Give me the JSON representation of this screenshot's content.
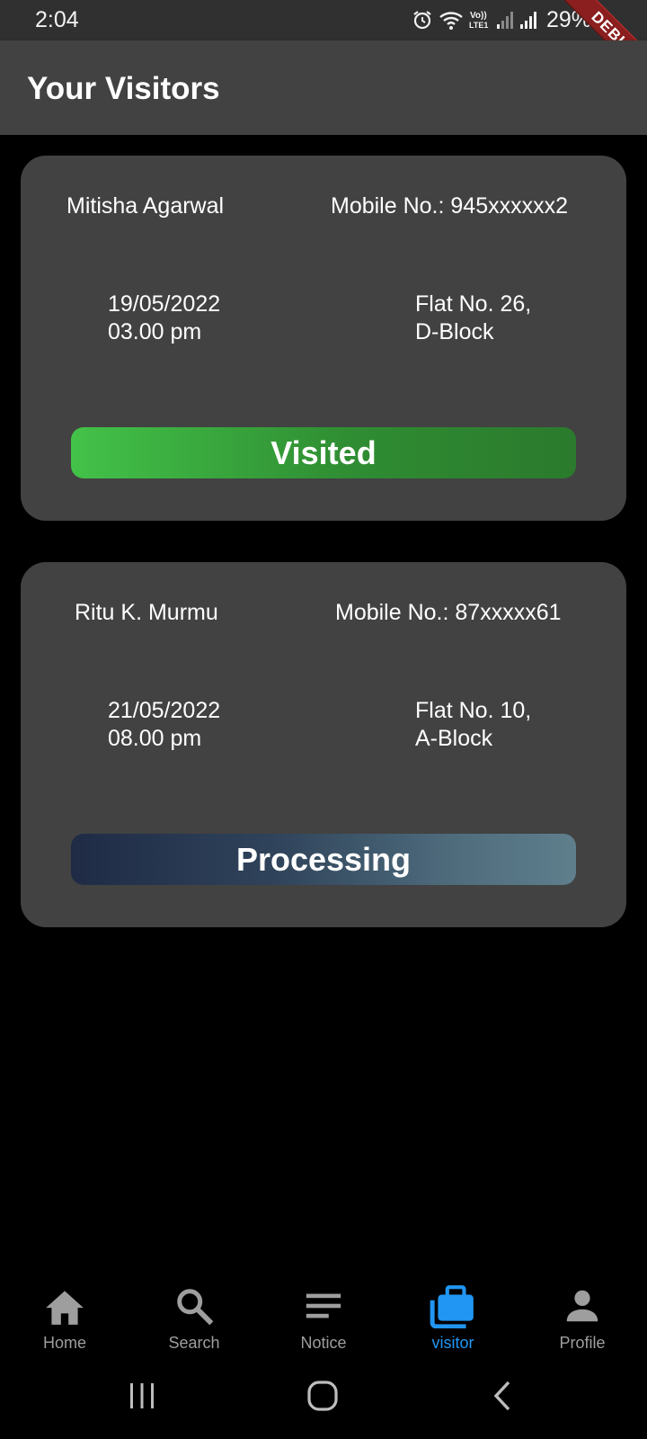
{
  "status_bar": {
    "time": "2:04",
    "battery": "29%"
  },
  "debug_label": "DEBUG",
  "app_bar": {
    "title": "Your Visitors"
  },
  "visitors": [
    {
      "name": "Mitisha Agarwal",
      "mobile": "Mobile No.: 945xxxxxx2",
      "date": "19/05/2022",
      "time": "03.00 pm",
      "flat_line1": "Flat No. 26,",
      "flat_line2": "D-Block",
      "status": "Visited"
    },
    {
      "name": "Ritu K. Murmu",
      "mobile": "Mobile No.: 87xxxxx61",
      "date": "21/05/2022",
      "time": "08.00 pm",
      "flat_line1": "Flat No. 10,",
      "flat_line2": "A-Block",
      "status": "Processing"
    }
  ],
  "bottom_nav": {
    "items": [
      {
        "label": "Home",
        "icon": "home-icon"
      },
      {
        "label": "Search",
        "icon": "search-icon"
      },
      {
        "label": "Notice",
        "icon": "notice-icon"
      },
      {
        "label": "visitor",
        "icon": "briefcase-icon"
      },
      {
        "label": "Profile",
        "icon": "person-icon"
      }
    ],
    "active_index": 3,
    "active_color": "#2196f3",
    "inactive_color": "#9e9e9e"
  },
  "colors": {
    "visited_gradient": [
      "#43c249",
      "#2b7a2d"
    ],
    "processing_gradient": [
      "#1f2b45",
      "#5f7f8d"
    ],
    "card_bg": "#424242"
  }
}
